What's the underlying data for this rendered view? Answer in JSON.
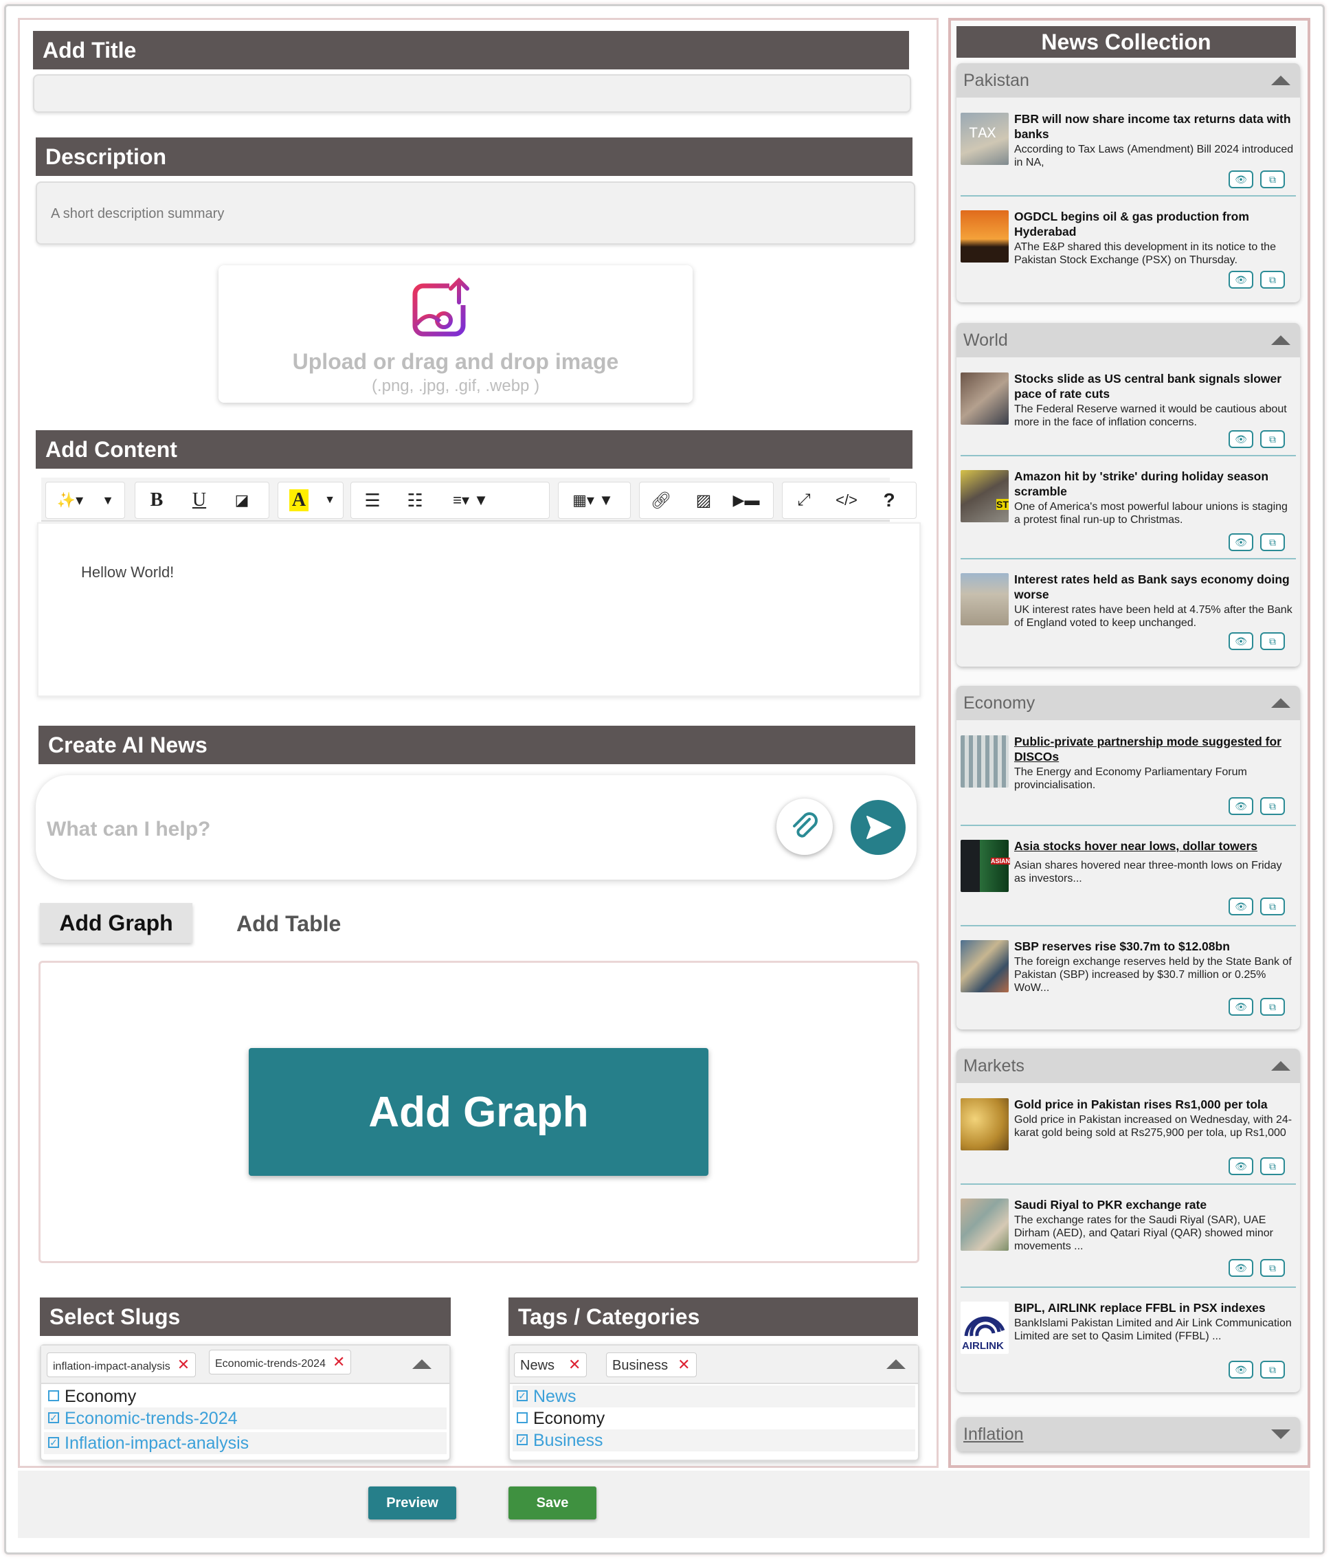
{
  "editor": {
    "title_header": "Add Title",
    "title_value": "",
    "description_header": "Description",
    "description_placeholder": "A short description summary",
    "upload_label": "Upload or drag and drop image",
    "upload_types": "(.png, .jpg, .gif, .webp )",
    "content_header": "Add Content",
    "content_text": "Hellow World!",
    "toolbar": {
      "bold": "B",
      "underline": "U",
      "help": "?",
      "code": "</>"
    },
    "ai_header": "Create AI News",
    "ai_placeholder": "What can I help?",
    "tabs": [
      "Add Graph",
      "Add Table"
    ],
    "add_graph_button": "Add Graph",
    "slugs_header": "Select Slugs",
    "slugs_selected": [
      "inflation-impact-analysis",
      "Economic-trends-2024"
    ],
    "slugs_options": [
      {
        "label": "Economy",
        "checked": false
      },
      {
        "label": "Economic-trends-2024",
        "checked": true
      },
      {
        "label": "Inflation-impact-analysis",
        "checked": true
      }
    ],
    "tags_header": "Tags / Categories",
    "tags_selected": [
      "News",
      "Business"
    ],
    "tags_options": [
      {
        "label": "News",
        "checked": true
      },
      {
        "label": "Economy",
        "checked": false
      },
      {
        "label": "Business",
        "checked": true
      }
    ],
    "preview_button": "Preview",
    "save_button": "Save",
    "colors": {
      "header": "#5c5555",
      "teal": "#267f8a",
      "save": "#3f9140",
      "check": "#3ba0d9"
    }
  },
  "news": {
    "title": "News Collection",
    "sections": [
      {
        "name": "Pakistan",
        "items": [
          {
            "title": "FBR will now share income tax returns data with banks",
            "text": "According to Tax Laws (Amendment) Bill 2024 introduced in NA,"
          },
          {
            "title": "OGDCL begins oil & gas production from Hyderabad",
            "text": "AThe E&P shared this development in its notice to the Pakistan Stock Exchange (PSX) on Thursday."
          }
        ]
      },
      {
        "name": "World",
        "items": [
          {
            "title": "Stocks slide as US central bank signals slower pace of rate cuts",
            "text": "The Federal Reserve warned it would be cautious about more   in the face of inflation concerns."
          },
          {
            "title": "Amazon hit by 'strike' during holiday season scramble",
            "text": "One of America's most powerful labour unions is staging a protest  final run-up to Christmas."
          },
          {
            "title": "Interest rates held as Bank says economy doing worse",
            "text": "UK interest rates have been held at 4.75% after the Bank of England voted to keep   unchanged."
          }
        ]
      },
      {
        "name": "Economy",
        "items": [
          {
            "title": "Public-private partnership mode suggested for DISCOs",
            "text": "The Energy and Economy Parliamentary Forum provincialisation."
          },
          {
            "title": "Asia stocks hover near lows, dollar towers",
            "text": "Asian shares hovered near three-month lows on Friday as investors..."
          },
          {
            "title": "SBP reserves rise $30.7m to $12.08bn",
            "text": "The foreign exchange reserves held by the State Bank of Pakistan (SBP) increased by $30.7 million or 0.25% WoW..."
          }
        ]
      },
      {
        "name": "Markets",
        "items": [
          {
            "title": "Gold price in Pakistan rises Rs1,000 per tola",
            "text": "Gold price in Pakistan increased on Wednesday, with 24-karat gold being sold at Rs275,900 per tola, up Rs1,000"
          },
          {
            "title": "Saudi Riyal to PKR exchange rate",
            "text": "The exchange rates for the Saudi Riyal (SAR), UAE Dirham (AED), and Qatari Riyal (QAR) showed minor movements ..."
          },
          {
            "title": "BIPL, AIRLINK replace FFBL in PSX indexes",
            "text": "BankIslami Pakistan Limited and Air Link Communication Limited are set to   Qasim Limited (FFBL)  ..."
          }
        ]
      },
      {
        "name": "Inflation",
        "items": []
      }
    ],
    "thumb_labels": {
      "tax": "TAX",
      "airlink": "AIRLINK",
      "st": "ST",
      "asian": "ASIAN"
    }
  }
}
